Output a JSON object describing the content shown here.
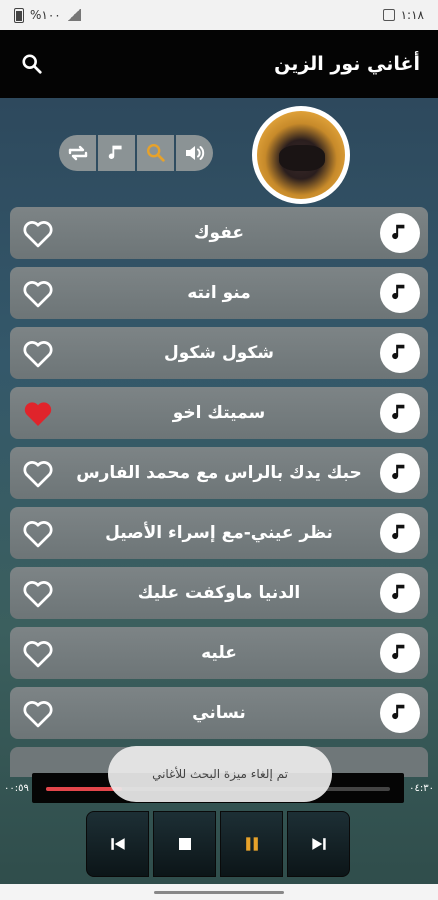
{
  "status_bar": {
    "battery": "%١٠٠",
    "time": "١:١٨"
  },
  "app_bar": {
    "title": "أغاني نور الزين",
    "search_icon": "search-icon"
  },
  "controls": [
    {
      "name": "repeat-icon"
    },
    {
      "name": "music-note-icon"
    },
    {
      "name": "search-icon",
      "color": "#e7a22a"
    },
    {
      "name": "volume-icon"
    }
  ],
  "songs": [
    {
      "title": "عفوك",
      "favorite": false
    },
    {
      "title": "منو انته",
      "favorite": false
    },
    {
      "title": "شكول شكول",
      "favorite": false
    },
    {
      "title": "سميتك اخو",
      "favorite": true
    },
    {
      "title": "حبك يدك بالراس مع محمد الفارس",
      "favorite": false
    },
    {
      "title": "نظر عيني-مع إسراء الأصيل",
      "favorite": false
    },
    {
      "title": "الدنيا ماوكفت عليك",
      "favorite": false
    },
    {
      "title": "عليه",
      "favorite": false
    },
    {
      "title": "نساني",
      "favorite": false
    }
  ],
  "player": {
    "elapsed": "٠٠:٥٩",
    "duration": "٠٤:٣٠",
    "progress": 0.22,
    "accent": "#e3464b",
    "pause_color": "#e7a22a"
  },
  "toast": {
    "message": "تم إلغاء ميزة البحث للأغاني"
  },
  "colors": {
    "heart_active": "#e0242b"
  }
}
